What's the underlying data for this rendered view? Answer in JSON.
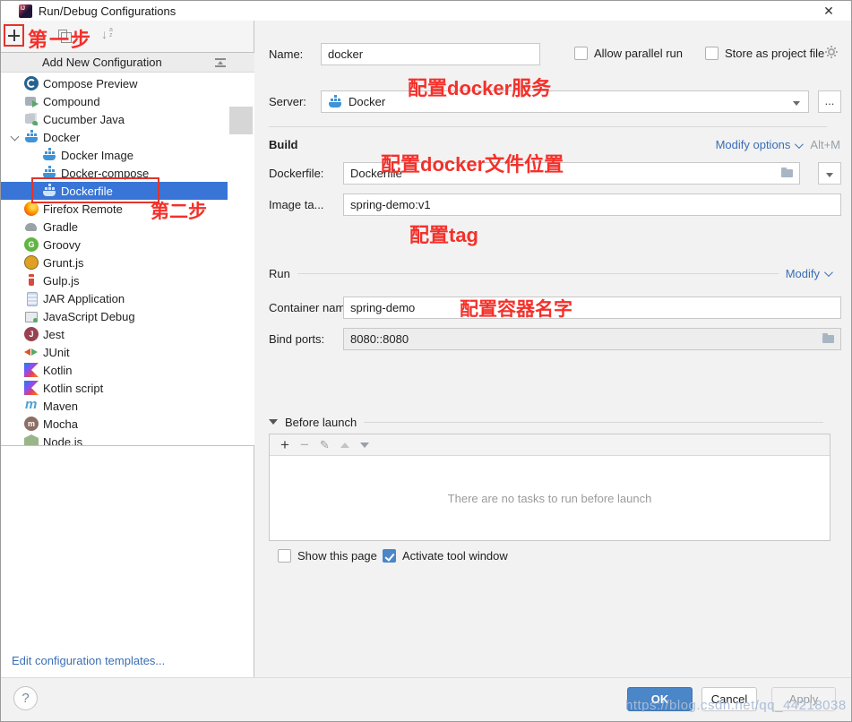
{
  "window": {
    "title": "Run/Debug Configurations",
    "close": "✕"
  },
  "toolbar": {
    "annotation_step1": "第一步"
  },
  "sidebar": {
    "header": "Add New Configuration",
    "items": [
      {
        "label": "Compose Preview",
        "icon": "compose-preview",
        "level": 0
      },
      {
        "label": "Compound",
        "icon": "compound",
        "level": 0
      },
      {
        "label": "Cucumber Java",
        "icon": "cucumber-java",
        "level": 0
      },
      {
        "label": "Docker",
        "icon": "docker",
        "level": 0,
        "expanded": true
      },
      {
        "label": "Docker Image",
        "icon": "docker",
        "level": 1
      },
      {
        "label": "Docker-compose",
        "icon": "docker",
        "level": 1
      },
      {
        "label": "Dockerfile",
        "icon": "docker",
        "level": 1,
        "selected": true
      },
      {
        "label": "Firefox Remote",
        "icon": "firefox",
        "level": 0
      },
      {
        "label": "Gradle",
        "icon": "gradle",
        "level": 0
      },
      {
        "label": "Groovy",
        "icon": "groovy",
        "level": 0
      },
      {
        "label": "Grunt.js",
        "icon": "grunt",
        "level": 0
      },
      {
        "label": "Gulp.js",
        "icon": "gulp",
        "level": 0
      },
      {
        "label": "JAR Application",
        "icon": "jar",
        "level": 0
      },
      {
        "label": "JavaScript Debug",
        "icon": "javascript-debug",
        "level": 0
      },
      {
        "label": "Jest",
        "icon": "jest",
        "level": 0
      },
      {
        "label": "JUnit",
        "icon": "junit",
        "level": 0
      },
      {
        "label": "Kotlin",
        "icon": "kotlin",
        "level": 0
      },
      {
        "label": "Kotlin script",
        "icon": "kotlin",
        "level": 0
      },
      {
        "label": "Maven",
        "icon": "maven",
        "level": 0
      },
      {
        "label": "Mocha",
        "icon": "mocha",
        "level": 0
      },
      {
        "label": "Node.js",
        "icon": "nodejs",
        "level": 0
      }
    ],
    "annotation_step2": "第二步",
    "edit_templates_link": "Edit configuration templates..."
  },
  "form": {
    "name_label": "Name:",
    "name_value": "docker",
    "allow_parallel_run_label": "Allow parallel run",
    "store_as_project_file_label": "Store as project file",
    "annotation_server": "配置docker服务",
    "server_label": "Server:",
    "server_value": "Docker",
    "dots_button": "...",
    "build": {
      "title": "Build",
      "modify_options_label": "Modify options",
      "shortcut": "Alt+M",
      "annotation_dockerfile": "配置docker文件位置",
      "dockerfile_label": "Dockerfile:",
      "dockerfile_value": "Dockerfile",
      "image_tag_label": "Image ta...",
      "image_tag_value": "spring-demo:v1",
      "annotation_tag": "配置tag"
    },
    "run": {
      "title": "Run",
      "modify_label": "Modify",
      "container_name_label": "Container name:",
      "container_name_value": "spring-demo",
      "annotation_container": "配置容器名字",
      "bind_ports_label": "Bind ports:",
      "bind_ports_value": "8080::8080"
    },
    "before_launch": {
      "title": "Before launch",
      "empty_text": "There are no tasks to run before launch"
    },
    "show_this_page_label": "Show this page",
    "activate_tool_window_label": "Activate tool window"
  },
  "footer": {
    "ok": "OK",
    "cancel": "Cancel",
    "apply": "Apply",
    "watermark": "https://blog.csdn.net/qq_44218038"
  },
  "colors": {
    "selection_blue": "#3875d6",
    "annotation_red": "#f5302a",
    "link_blue": "#3b6eb5",
    "ok_button_blue": "#4a86c8"
  }
}
